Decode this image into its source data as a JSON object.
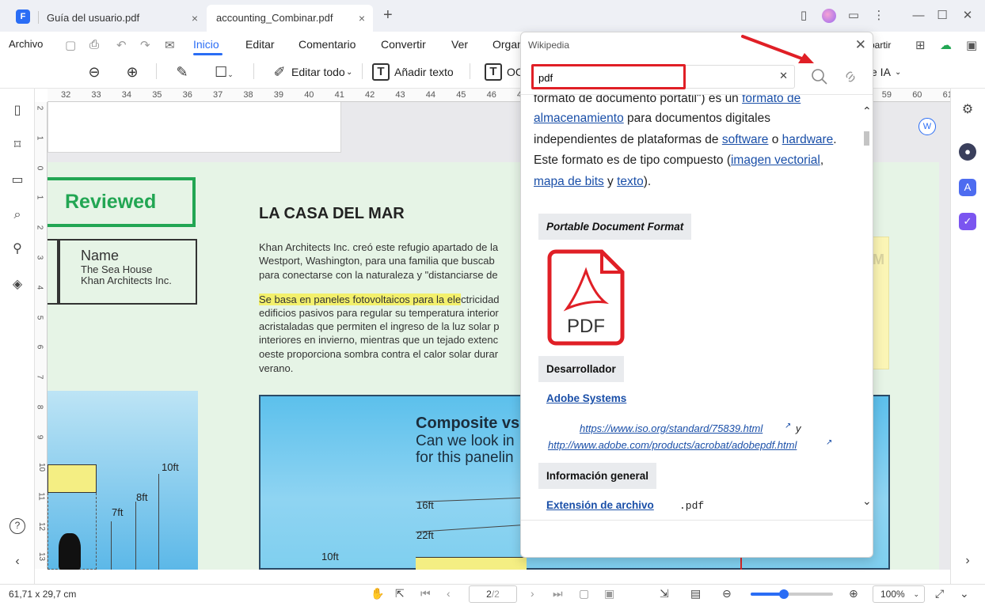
{
  "titlebar": {
    "tabs": [
      {
        "label": "Guía del usuario.pdf",
        "active": false
      },
      {
        "label": "accounting_Combinar.pdf",
        "active": true
      }
    ],
    "new_tab": "+",
    "close": "×"
  },
  "menubar": {
    "items": [
      "Archivo",
      "Inicio",
      "Editar",
      "Comentario",
      "Convertir",
      "Ver",
      "Organ"
    ],
    "active": "Inicio",
    "share_label": "partir"
  },
  "toolbar": {
    "edit_all": "Editar todo",
    "add_text": "Añadir texto",
    "ocr": "OC",
    "ai": "e IA"
  },
  "ruler": {
    "h": [
      "32",
      "33",
      "34",
      "35",
      "36",
      "37",
      "38",
      "39",
      "40",
      "41",
      "42",
      "43",
      "44",
      "45",
      "46",
      "47",
      "48",
      "49",
      "50",
      "51",
      "52",
      "53",
      "54",
      "55",
      "56",
      "57",
      "58",
      "59",
      "60",
      "61"
    ],
    "v": [
      "2",
      "1",
      "0",
      "1",
      "2",
      "3",
      "4",
      "5",
      "6",
      "7",
      "8",
      "9",
      "10",
      "11",
      "12",
      "13"
    ]
  },
  "document": {
    "reviewed": "Reviewed",
    "name_title": "Name",
    "name_line1": "The Sea House",
    "name_line2": "Khan Architects Inc.",
    "title": "LA CASA DEL MAR",
    "para1": [
      "Khan Architects Inc. creó este refugio apartado de la",
      "Westport, Washington, para una familia que buscab",
      "para conectarse con la naturaleza y \"distanciarse de"
    ],
    "para2_highlight": "Se basa en paneles fotovoltaicos para la ele",
    "para2_first_rest": "ctricidad",
    "para2": [
      "edificios pasivos para regular su temperatura interior",
      "acristaladas que permiten el ingreso de la luz solar p",
      "interiores en invierno, mientras que un tejado extenc",
      "oeste proporciona sombra contra el calor solar durar",
      "verano."
    ],
    "note_letter": "M",
    "composite_title": "Composite vs",
    "composite_sub1": "Can we look in",
    "composite_sub2": "for this panelin",
    "m_10ft": "10ft",
    "m_8ft": "8ft",
    "m_7ft": "7ft",
    "m_16ft": "16ft",
    "m_22ft": "22ft",
    "m_10ft_b": "10ft"
  },
  "wiki": {
    "title": "Wikipedia",
    "search_value": "pdf",
    "lines": [
      {
        "parts": [
          {
            "t": "formato de documento portátil\") es un ",
            "link": false
          },
          {
            "t": "formato de",
            "link": true
          }
        ]
      },
      {
        "parts": [
          {
            "t": "almacenamiento",
            "link": true
          },
          {
            "t": " para documentos digitales",
            "link": false
          }
        ]
      },
      {
        "parts": [
          {
            "t": "independientes de plataformas de ",
            "link": false
          },
          {
            "t": "software",
            "link": true
          },
          {
            "t": " o ",
            "link": false
          },
          {
            "t": "hardware",
            "link": true
          },
          {
            "t": ".",
            "link": false
          }
        ]
      },
      {
        "parts": [
          {
            "t": "Este formato es de tipo compuesto (",
            "link": false
          },
          {
            "t": "imagen vectorial",
            "link": true
          },
          {
            "t": ",",
            "link": false
          }
        ]
      },
      {
        "parts": [
          {
            "t": "mapa de bits",
            "link": true
          },
          {
            "t": " y ",
            "link": false
          },
          {
            "t": "texto",
            "link": true
          },
          {
            "t": ").",
            "link": false
          }
        ]
      }
    ],
    "infobox_title": "Portable Document Format",
    "pdf_label": "PDF",
    "developer_header": "Desarrollador",
    "developer": "Adobe Systems",
    "url1": "https://www.iso.org/standard/75839.html",
    "url_y": "y",
    "url2": "http://www.adobe.com/products/acrobat/adobepdf.html",
    "general_header": "Información general",
    "ext_label": "Extensión de archivo",
    "ext_value": ".pdf"
  },
  "statusbar": {
    "dimensions": "61,71 x 29,7 cm",
    "page": "2",
    "page_total": "/2",
    "zoom": "100%",
    "zoom_level": 0.4
  },
  "colors": {
    "accent": "#2a6df5",
    "reviewed": "#22a653",
    "annotation_red": "#e01f26",
    "link": "#1a4fa8"
  }
}
